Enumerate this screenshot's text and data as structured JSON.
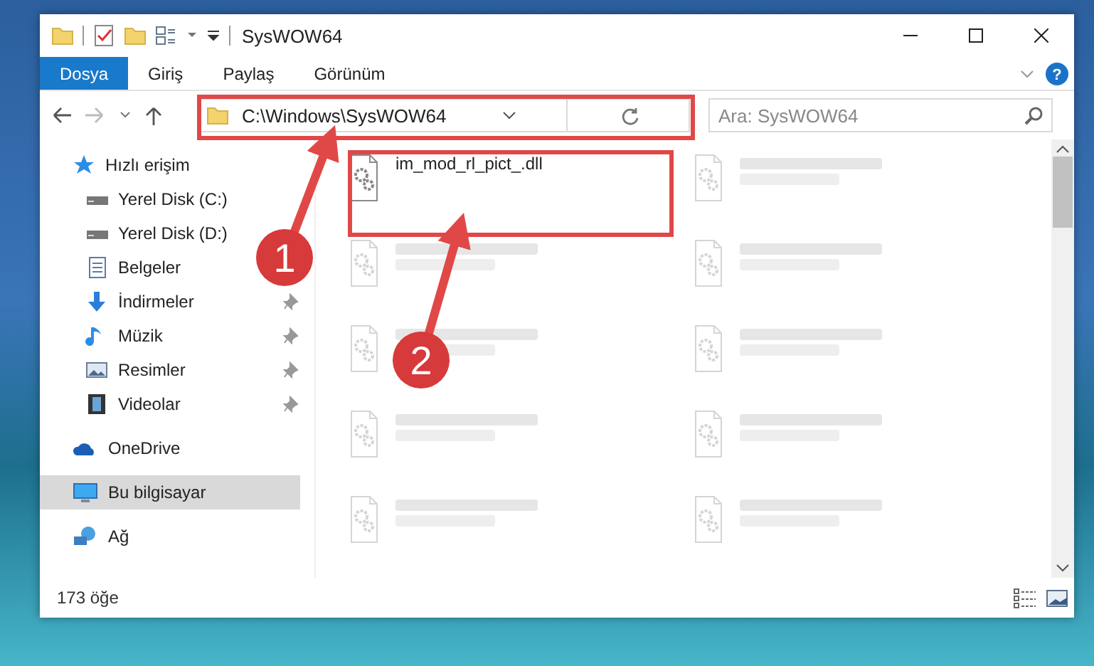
{
  "window": {
    "title": "SysWOW64"
  },
  "ribbon": {
    "tabs": [
      {
        "label": "Dosya",
        "selected": true
      },
      {
        "label": "Giriş",
        "selected": false
      },
      {
        "label": "Paylaş",
        "selected": false
      },
      {
        "label": "Görünüm",
        "selected": false
      }
    ],
    "help": "?"
  },
  "address_bar": {
    "path": "C:\\Windows\\SysWOW64"
  },
  "search": {
    "placeholder": "Ara: SysWOW64"
  },
  "sidebar": {
    "items": [
      {
        "label": "Hızlı erişim",
        "kind": "star",
        "selected": false,
        "children": [
          {
            "label": "Yerel Disk (C:)",
            "kind": "drive",
            "selected": false,
            "pinned": false
          },
          {
            "label": "Yerel Disk (D:)",
            "kind": "drive",
            "selected": false,
            "pinned": false
          },
          {
            "label": "Belgeler",
            "kind": "doc",
            "selected": false,
            "pinned": false
          },
          {
            "label": "İndirmeler",
            "kind": "download",
            "selected": false,
            "pinned": true
          },
          {
            "label": "Müzik",
            "kind": "music",
            "selected": false,
            "pinned": true
          },
          {
            "label": "Resimler",
            "kind": "picture",
            "selected": false,
            "pinned": true
          },
          {
            "label": "Videolar",
            "kind": "video",
            "selected": false,
            "pinned": true
          }
        ]
      },
      {
        "label": "OneDrive",
        "kind": "cloud",
        "selected": false
      },
      {
        "label": "Bu bilgisayar",
        "kind": "computer",
        "selected": true
      },
      {
        "label": "Ağ",
        "kind": "network",
        "selected": false
      }
    ]
  },
  "files": [
    {
      "name": "im_mod_rl_pict_.dll",
      "faded": false
    },
    {
      "faded": true
    },
    {
      "faded": true
    },
    {
      "faded": true
    },
    {
      "faded": true
    },
    {
      "faded": true
    },
    {
      "faded": true
    },
    {
      "faded": true
    },
    {
      "faded": true
    },
    {
      "faded": true
    }
  ],
  "status_bar": {
    "item_count": "173 öğe"
  },
  "annotations": [
    {
      "number": "1"
    },
    {
      "number": "2"
    }
  ]
}
